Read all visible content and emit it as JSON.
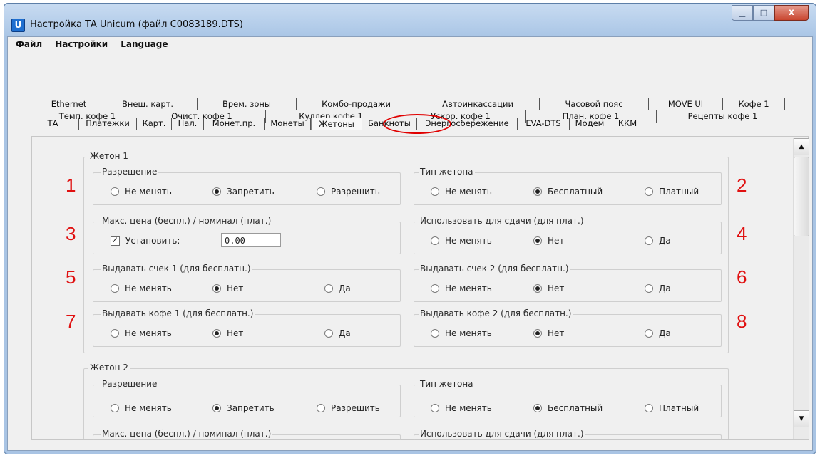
{
  "window": {
    "title": "Настройка ТА Unicum (файл C0083189.DTS)",
    "icon_letter": "U",
    "minimize_symbol": "▁",
    "maximize_symbol": "□",
    "close_symbol": "x"
  },
  "menu": [
    "Файл",
    "Настройки",
    "Language"
  ],
  "tabs": {
    "row1": [
      "Ethernet",
      "Внеш. карт.",
      "Врем. зоны",
      "Комбо-продажи",
      "Автоинкассации",
      "Часовой пояс",
      "MOVE UI",
      "Кофе 1"
    ],
    "row2": [
      "Темп. кофе 1",
      "Очист. кофе 1",
      "Куллер кофе 1",
      "Ускор. кофе 1",
      "План. кофе 1",
      "Рецепты кофе 1"
    ],
    "row3": [
      "ТА",
      "Платежки",
      "Карт.",
      "Нал.",
      "Монет.пр.",
      "Монеты",
      "Жетоны",
      "Банкноты",
      "Энергосбережение",
      "EVA-DTS",
      "Модем",
      "ККМ"
    ],
    "active": "Жетоны"
  },
  "annotations": [
    "1",
    "2",
    "3",
    "4",
    "5",
    "6",
    "7",
    "8"
  ],
  "jeton1": {
    "title": "Жетон 1",
    "permission": {
      "label": "Разрешение",
      "options": [
        "Не менять",
        "Запретить",
        "Разрешить"
      ],
      "selected": 1
    },
    "type": {
      "label": "Тип жетона",
      "options": [
        "Не менять",
        "Бесплатный",
        "Платный"
      ],
      "selected": 1
    },
    "max_price": {
      "label": "Макс. цена (беспл.) / номинал (плат.)",
      "checkbox_label": "Установить:",
      "checked": true,
      "value": "0.00"
    },
    "change": {
      "label": "Использовать для сдачи (для плат.)",
      "options": [
        "Не менять",
        "Нет",
        "Да"
      ],
      "selected": 1
    },
    "check1": {
      "label": "Выдавать счек 1 (для бесплатн.)",
      "options": [
        "Не менять",
        "Нет",
        "Да"
      ],
      "selected": 1
    },
    "check2": {
      "label": "Выдавать счек 2 (для бесплатн.)",
      "options": [
        "Не менять",
        "Нет",
        "Да"
      ],
      "selected": 1
    },
    "coffee1": {
      "label": "Выдавать кофе 1 (для бесплатн.)",
      "options": [
        "Не менять",
        "Нет",
        "Да"
      ],
      "selected": 1
    },
    "coffee2": {
      "label": "Выдавать кофе 2 (для бесплатн.)",
      "options": [
        "Не менять",
        "Нет",
        "Да"
      ],
      "selected": 1
    }
  },
  "jeton2": {
    "title": "Жетон 2",
    "permission": {
      "label": "Разрешение",
      "options": [
        "Не менять",
        "Запретить",
        "Разрешить"
      ],
      "selected": 1
    },
    "type": {
      "label": "Тип жетона",
      "options": [
        "Не менять",
        "Бесплатный",
        "Платный"
      ],
      "selected": 1
    },
    "max_price_label": "Макс. цена (беспл.) / номинал (плат.)",
    "change_label": "Использовать для сдачи (для плат.)"
  },
  "scrollbar": {
    "up_symbol": "▲",
    "down_symbol": "▼"
  },
  "colors": {
    "annotation": "#e01010",
    "highlight_ring": "#e00000"
  }
}
